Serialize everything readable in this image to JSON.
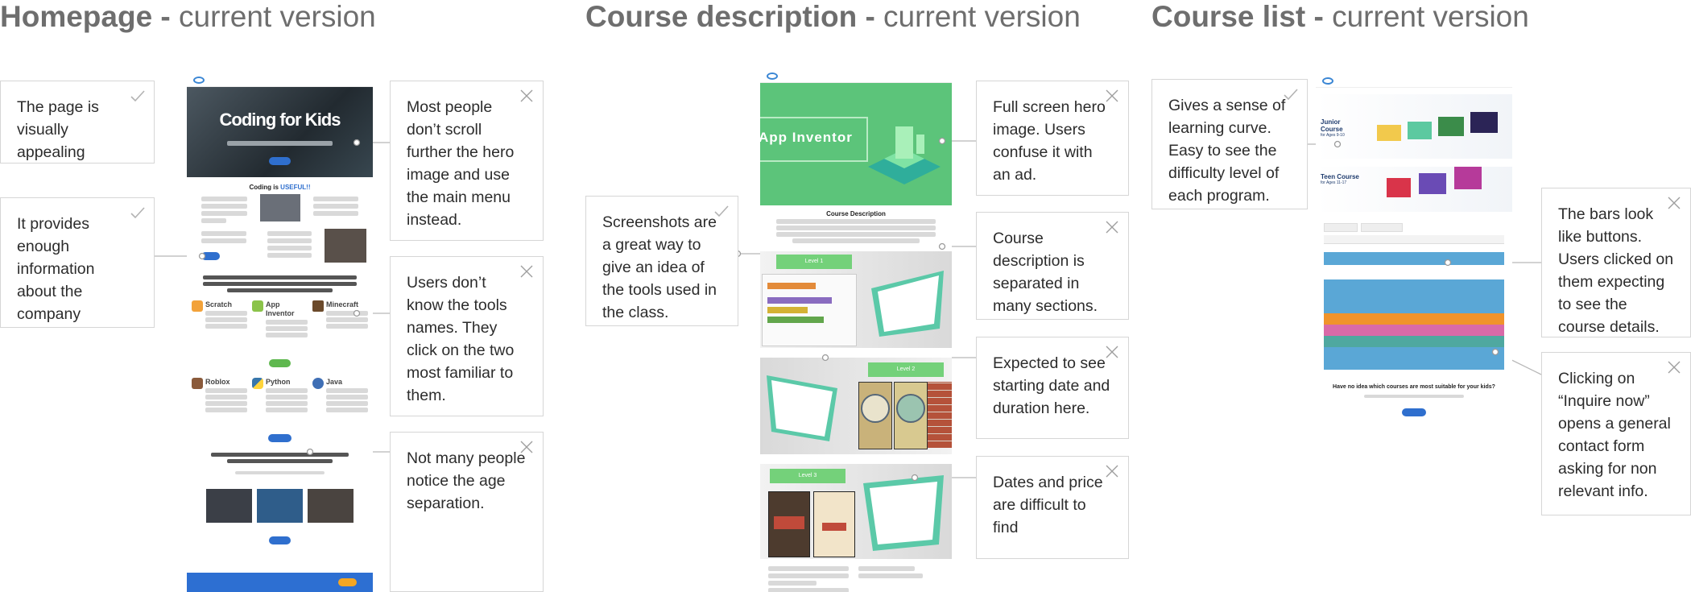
{
  "titles": [
    {
      "bold": "Homepage -",
      "light": " current version"
    },
    {
      "bold": "Course description -",
      "light": " current version"
    },
    {
      "bold": "Course list -",
      "light": " current version"
    }
  ],
  "notes": {
    "hp_appealing": {
      "text": "The page is visually appealing",
      "mark": "check"
    },
    "hp_info": {
      "text": "It provides enough information about the company",
      "mark": "check"
    },
    "hp_scroll": {
      "text": "Most people don’t scroll further the hero image and use the main menu instead.",
      "mark": "cross"
    },
    "hp_tools": {
      "text": "Users don’t know the tools names. They click on the two most familiar to them.",
      "mark": "cross"
    },
    "hp_age": {
      "text": "Not many people notice the age separation.",
      "mark": "cross"
    },
    "cd_screens": {
      "text": "Screenshots are a great way to give an idea of the tools used in the class.",
      "mark": "check"
    },
    "cd_hero": {
      "text": "Full screen hero image. Users confuse it with an ad.",
      "mark": "cross"
    },
    "cd_sections": {
      "text": "Course description is separated in many sections.",
      "mark": "cross"
    },
    "cd_date": {
      "text": "Expected to see starting date and duration here.",
      "mark": "cross"
    },
    "cd_price": {
      "text": "Dates and price are difficult to find",
      "mark": "cross"
    },
    "cl_curve": {
      "text": "Gives a sense of learning curve. Easy to see the difficulty level of each program.",
      "mark": "check"
    },
    "cl_bars": {
      "text": "The bars look like buttons. Users clicked on them expecting to see the course details.",
      "mark": "cross"
    },
    "cl_inquire": {
      "text": "Clicking on “Inquire now” opens a general contact form asking for non relevant info.",
      "mark": "cross"
    }
  },
  "homepage": {
    "hero_title": "Coding for Kids",
    "section_heading_pre": "Coding is ",
    "section_heading_em": "USEFUL!!",
    "tools": [
      "Scratch",
      "App Inventor",
      "Minecraft",
      "Roblox",
      "Python",
      "Java"
    ]
  },
  "course_desc": {
    "hero_title": "App Inventor",
    "section_title": "Course Description",
    "levels": [
      "Level 1",
      "Level 2",
      "Level 3"
    ]
  },
  "course_list": {
    "junior": {
      "title": "Junior Course",
      "sub": "for Ages 9-10"
    },
    "teen": {
      "title": "Teen Course",
      "sub": "for Ages 11-17"
    },
    "cta_heading": "Have no idea which courses are most suitable for your kids?"
  },
  "colors": {
    "check": "#b3b3b3",
    "cross": "#9e9e9e",
    "hero_green": "#5cc47a",
    "bar_blue": "#5aa7d6",
    "bar_orange": "#f0932b",
    "bar_pink": "#d96aa8",
    "bar_teal": "#4fa8a0"
  }
}
